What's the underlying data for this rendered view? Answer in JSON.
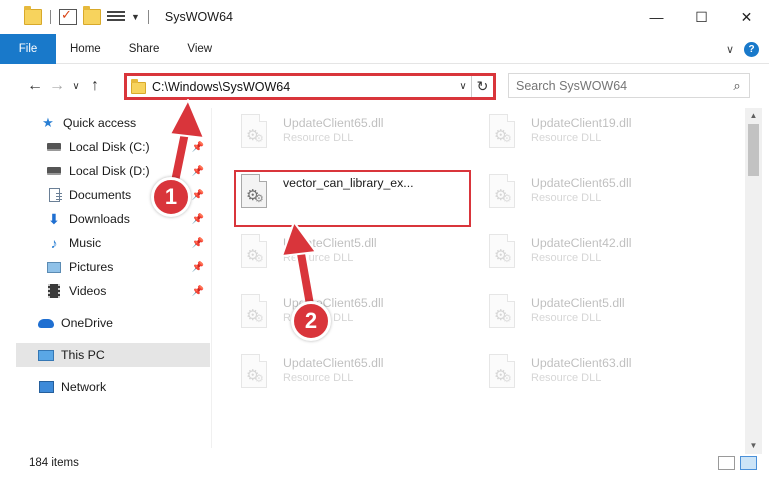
{
  "window": {
    "title": "SysWOW64",
    "minimize_glyph": "—",
    "maximize_glyph": "☐",
    "close_glyph": "✕"
  },
  "ribbon": {
    "tabs": [
      "File",
      "Home",
      "Share",
      "View"
    ],
    "help_label": "?"
  },
  "address": {
    "path": "C:\\Windows\\SysWOW64",
    "search_placeholder": "Search SysWOW64"
  },
  "sidebar": {
    "items": [
      {
        "label": "Quick access",
        "icon": "star-icon",
        "pinned": false
      },
      {
        "label": "Local Disk (C:)",
        "icon": "disk-icon",
        "pinned": true
      },
      {
        "label": "Local Disk (D:)",
        "icon": "disk-icon",
        "pinned": true
      },
      {
        "label": "Documents",
        "icon": "documents-icon",
        "pinned": true
      },
      {
        "label": "Downloads",
        "icon": "downloads-icon",
        "pinned": true
      },
      {
        "label": "Music",
        "icon": "music-icon",
        "pinned": true
      },
      {
        "label": "Pictures",
        "icon": "pictures-icon",
        "pinned": true
      },
      {
        "label": "Videos",
        "icon": "videos-icon",
        "pinned": true
      },
      {
        "label": "OneDrive",
        "icon": "onedrive-icon",
        "pinned": false
      },
      {
        "label": "This PC",
        "icon": "this-pc-icon",
        "pinned": false,
        "selected": true
      },
      {
        "label": "Network",
        "icon": "network-icon",
        "pinned": false
      }
    ]
  },
  "files": [
    {
      "name": "UpdateClient65.dll",
      "type": "Resource DLL",
      "faded": true
    },
    {
      "name": "UpdateClient19.dll",
      "type": "Resource DLL",
      "faded": true
    },
    {
      "name": "vector_can_library_ex...",
      "type": "",
      "faded": false
    },
    {
      "name": "UpdateClient65.dll",
      "type": "Resource DLL",
      "faded": true
    },
    {
      "name": "UpdateClient5.dll",
      "type": "Resource DLL",
      "faded": true
    },
    {
      "name": "UpdateClient42.dll",
      "type": "Resource DLL",
      "faded": true
    },
    {
      "name": "UpdateClient65.dll",
      "type": "Resource DLL",
      "faded": true
    },
    {
      "name": "UpdateClient5.dll",
      "type": "Resource DLL",
      "faded": true
    },
    {
      "name": "UpdateClient65.dll",
      "type": "Resource DLL",
      "faded": true
    },
    {
      "name": "UpdateClient63.dll",
      "type": "Resource DLL",
      "faded": true
    }
  ],
  "status": {
    "item_count": "184 items"
  },
  "annotations": {
    "step1": "1",
    "step2": "2",
    "accent_color": "#d9353b"
  }
}
